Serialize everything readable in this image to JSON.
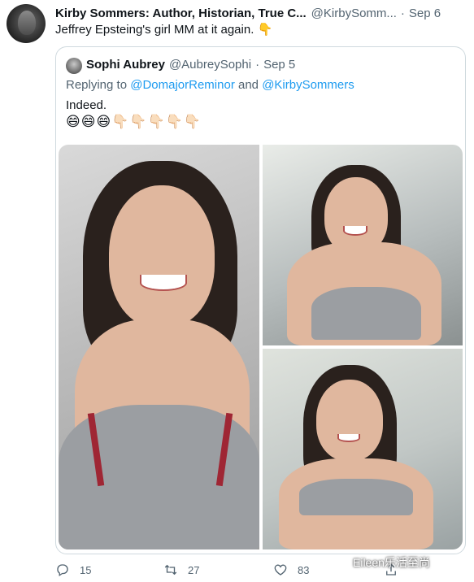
{
  "tweet": {
    "author_name": "Kirby Sommers: Author, Historian, True C...",
    "author_handle": "@KirbySomm...",
    "separator": "·",
    "time": "Sep 6",
    "text": "Jeffrey Epsteing's girl MM at it again. 👇"
  },
  "quoted_tweet": {
    "author_name": "Sophi Aubrey",
    "author_handle": "@AubreySophi",
    "separator": "·",
    "time": "Sep 5",
    "reply_prefix": "Replying to ",
    "reply_user_1": "@DomajorReminor",
    "reply_and": " and ",
    "reply_user_2": "@KirbySommers",
    "text": "Indeed.",
    "emoji": "😄😄😄👇🏻👇🏻👇🏻👇🏻👇🏻"
  },
  "actions": {
    "reply_count": "15",
    "retweet_count": "27",
    "like_count": "83"
  },
  "watermark": "Eileen乐活至尚",
  "colors": {
    "accent": "#1d9bf0",
    "secondary_text": "#536471",
    "border": "#cfd9de"
  }
}
